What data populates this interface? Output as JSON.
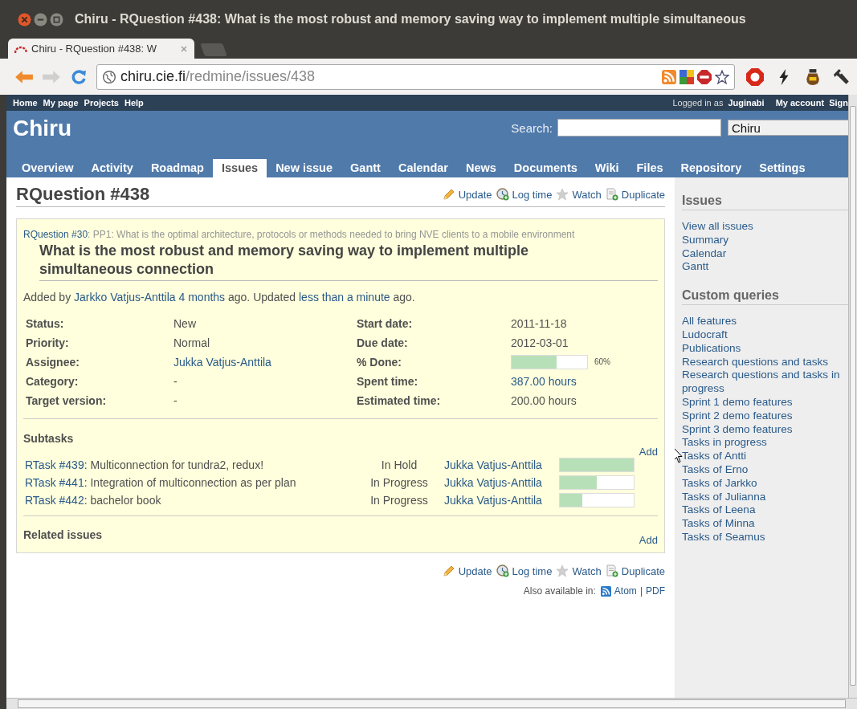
{
  "window": {
    "title": "Chiru - RQuestion #438: What is the most robust and memory saving way to implement multiple simultaneous"
  },
  "tab": {
    "title": "Chiru - RQuestion #438: W"
  },
  "address_bar": {
    "host": "chiru.cie.fi",
    "path": "/redmine/issues/438"
  },
  "top_menu": {
    "items": [
      "Home",
      "My page",
      "Projects",
      "Help"
    ],
    "logged_in_label": "Logged in as",
    "user": "Juginabi",
    "account_items": [
      "My account",
      "Sign"
    ]
  },
  "header": {
    "title": "Chiru",
    "search_label": "Search:",
    "project_select": "Chiru"
  },
  "main_menu": [
    {
      "label": "Overview",
      "selected": false
    },
    {
      "label": "Activity",
      "selected": false
    },
    {
      "label": "Roadmap",
      "selected": false
    },
    {
      "label": "Issues",
      "selected": true
    },
    {
      "label": "New issue",
      "selected": false
    },
    {
      "label": "Gantt",
      "selected": false
    },
    {
      "label": "Calendar",
      "selected": false
    },
    {
      "label": "News",
      "selected": false
    },
    {
      "label": "Documents",
      "selected": false
    },
    {
      "label": "Wiki",
      "selected": false
    },
    {
      "label": "Files",
      "selected": false
    },
    {
      "label": "Repository",
      "selected": false
    },
    {
      "label": "Settings",
      "selected": false
    }
  ],
  "issue": {
    "title": "RQuestion #438",
    "actions": [
      {
        "kind": "edit",
        "label": "Update"
      },
      {
        "kind": "time",
        "label": "Log time"
      },
      {
        "kind": "watch",
        "label": "Watch"
      },
      {
        "kind": "copy",
        "label": "Duplicate"
      }
    ],
    "parent": {
      "link": "RQuestion #30",
      "text": ": PP1: What is the optimal architecture, protocols or methods needed to bring NVE clients to a mobile environment"
    },
    "subject": "What is the most robust and memory saving way to implement multiple simultaneous connection",
    "author_line": [
      {
        "kind": "text",
        "text": "Added by "
      },
      {
        "kind": "link",
        "text": "Jarkko Vatjus-Anttila"
      },
      {
        "kind": "link",
        "text": "4 months"
      },
      {
        "kind": "text",
        "text": " ago. Updated "
      },
      {
        "kind": "link",
        "text": "less than a minute"
      },
      {
        "kind": "text",
        "text": " ago."
      }
    ],
    "attribute_rows": [
      {
        "left": {
          "label": "Status:",
          "kind": "text",
          "value": "New"
        },
        "right": {
          "label": "Start date:",
          "kind": "text",
          "value": "2011-11-18"
        }
      },
      {
        "left": {
          "label": "Priority:",
          "kind": "text",
          "value": "Normal"
        },
        "right": {
          "label": "Due date:",
          "kind": "text",
          "value": "2012-03-01"
        }
      },
      {
        "left": {
          "label": "Assignee:",
          "kind": "link",
          "value": "Jukka Vatjus-Anttila"
        },
        "right": {
          "label": "% Done:",
          "kind": "progress",
          "level": 0.6,
          "value": "60%"
        }
      },
      {
        "left": {
          "label": "Category:",
          "kind": "text",
          "value": "-"
        },
        "right": {
          "label": "Spent time:",
          "kind": "link",
          "value": "387.00 hours"
        }
      },
      {
        "left": {
          "label": "Target version:",
          "kind": "text",
          "value": "-"
        },
        "right": {
          "label": "Estimated time:",
          "kind": "text",
          "value": "200.00 hours"
        }
      }
    ],
    "subtasks": {
      "heading": "Subtasks",
      "add": "Add",
      "rows": [
        {
          "id": "RTask #439",
          "subject": ": Multiconnection for tundra2, redux!",
          "status": "In Hold",
          "assignee": "Jukka Vatjus-Anttila",
          "level": 1
        },
        {
          "id": "RTask #441",
          "subject": ": Integration of multiconnection as per plan",
          "status": "In Progress",
          "assignee": "Jukka Vatjus-Anttila",
          "level": 0.5
        },
        {
          "id": "RTask #442",
          "subject": ": bachelor book",
          "status": "In Progress",
          "assignee": "Jukka Vatjus-Anttila",
          "level": 0.3
        }
      ]
    },
    "related": {
      "heading": "Related issues",
      "add": "Add"
    },
    "bottom_actions": [
      {
        "kind": "edit",
        "label": "Update"
      },
      {
        "kind": "time",
        "label": "Log time"
      },
      {
        "kind": "watch",
        "label": "Watch"
      },
      {
        "kind": "copy",
        "label": "Duplicate"
      }
    ],
    "also_available": {
      "label": "Also available in:",
      "separator": "|",
      "formats": [
        {
          "kind": "feed",
          "label": "Atom"
        },
        {
          "kind": "plain",
          "label": "PDF"
        }
      ]
    }
  },
  "sidebar": [
    {
      "heading": "Issues",
      "items": [
        "View all issues",
        "Summary",
        "Calendar",
        "Gantt"
      ]
    },
    {
      "heading": "Custom queries",
      "items": [
        "All features",
        "Ludocraft",
        "Publications",
        "Research questions and tasks",
        "Research questions and tasks in progress",
        "Sprint 1 demo features",
        "Sprint 2 demo features",
        "Sprint 3 demo features",
        "Tasks in progress",
        "Tasks of Antti",
        "Tasks of Erno",
        "Tasks of Jarkko",
        "Tasks of Julianna",
        "Tasks of Leena",
        "Tasks of Minna",
        "Tasks of Seamus"
      ]
    }
  ]
}
